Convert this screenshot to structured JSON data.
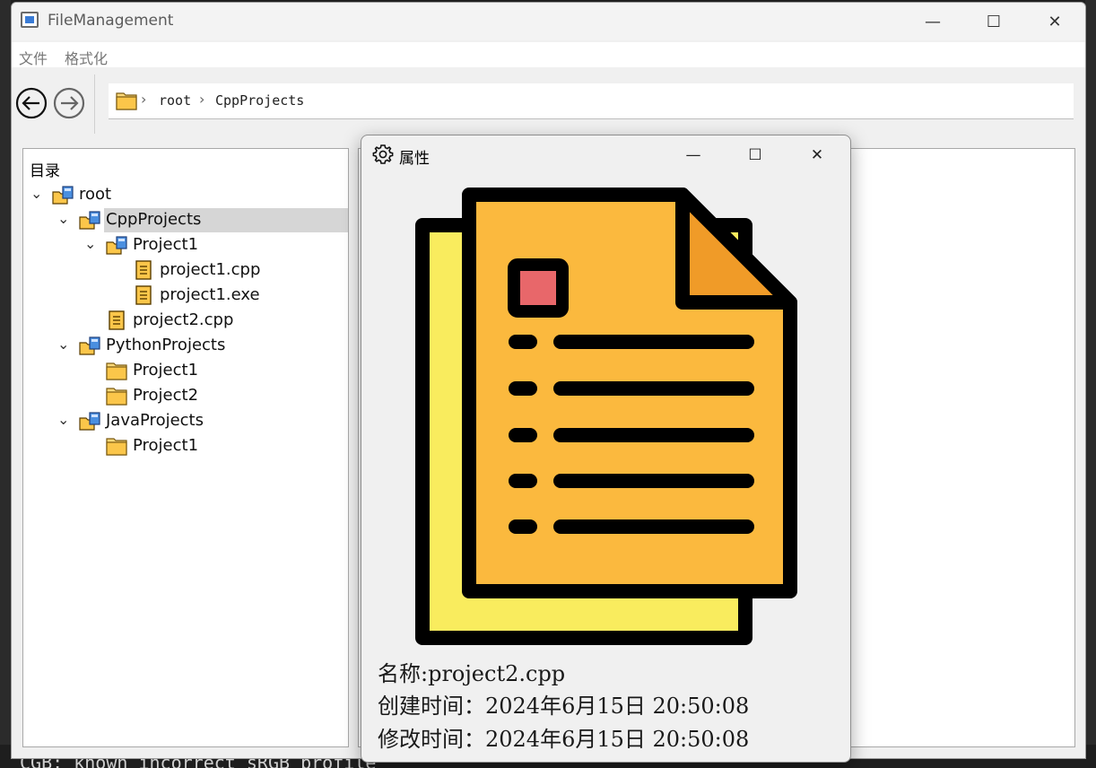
{
  "window": {
    "title": "FileManagement",
    "controls": {
      "minimize": "—",
      "maximize": "☐",
      "close": "✕"
    }
  },
  "menu": [
    "文件",
    "格式化"
  ],
  "toolbar": {
    "back_icon": "arrow-left-circle-icon",
    "forward_icon": "arrow-right-circle-icon",
    "breadcrumb": [
      "root",
      "CppProjects"
    ]
  },
  "tree": {
    "header": "目录",
    "items": [
      {
        "label": "root",
        "type": "project-folder",
        "depth": 0,
        "expanded": true
      },
      {
        "label": "CppProjects",
        "type": "project-folder",
        "depth": 1,
        "expanded": true,
        "selected": true
      },
      {
        "label": "Project1",
        "type": "project-folder",
        "depth": 2,
        "expanded": true
      },
      {
        "label": "project1.cpp",
        "type": "file",
        "depth": 3
      },
      {
        "label": "project1.exe",
        "type": "file",
        "depth": 3
      },
      {
        "label": "project2.cpp",
        "type": "file",
        "depth": 2
      },
      {
        "label": "PythonProjects",
        "type": "project-folder",
        "depth": 1,
        "expanded": true
      },
      {
        "label": "Project1",
        "type": "folder",
        "depth": 2
      },
      {
        "label": "Project2",
        "type": "folder",
        "depth": 2
      },
      {
        "label": "JavaProjects",
        "type": "project-folder",
        "depth": 1,
        "expanded": true
      },
      {
        "label": "Project1",
        "type": "folder",
        "depth": 2
      }
    ]
  },
  "dialog": {
    "title": "属性",
    "icon": "gear-icon",
    "controls": {
      "minimize": "—",
      "maximize": "☐",
      "close": "✕"
    },
    "name_line": "名称:project2.cpp",
    "created_line": "创建时间：2024年6月15日 20:50:08",
    "modified_line": "修改时间：2024年6月15日 20:50:08"
  },
  "background": {
    "bottom_text": "CGB: known incorrect sRGB profile"
  },
  "colors": {
    "doc_front": "#fbb93e",
    "doc_back": "#f9ec5e",
    "doc_fold": "#f09b28",
    "doc_square": "#e8676a",
    "selected_row": "#d6d6d6"
  }
}
